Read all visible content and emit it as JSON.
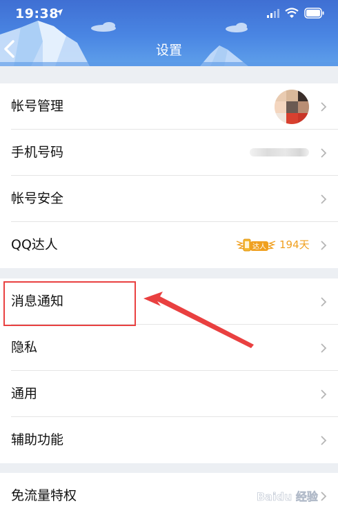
{
  "status_bar": {
    "time": "19:38"
  },
  "header": {
    "title": "设置"
  },
  "groups": [
    {
      "rows": [
        {
          "label": "帐号管理"
        },
        {
          "label": "手机号码"
        },
        {
          "label": "帐号安全"
        },
        {
          "label": "QQ达人",
          "badge": "达人",
          "days": "194天"
        }
      ]
    },
    {
      "rows": [
        {
          "label": "消息通知"
        },
        {
          "label": "隐私"
        },
        {
          "label": "通用"
        },
        {
          "label": "辅助功能"
        }
      ]
    },
    {
      "rows": [
        {
          "label": "免流量特权"
        }
      ]
    }
  ],
  "watermark": {
    "text": "Baidu 经验"
  },
  "colors": {
    "header": "#4a86e3",
    "highlight": "#e94040",
    "talent": "#f0a020"
  }
}
